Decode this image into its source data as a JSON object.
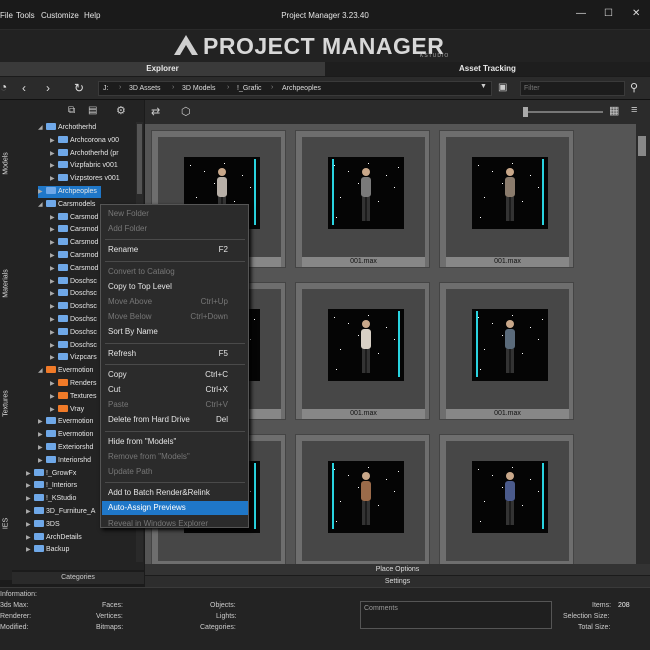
{
  "menu": {
    "file": "File",
    "tools": "Tools",
    "customize": "Customize",
    "help": "Help"
  },
  "window": {
    "title": "Project Manager 3.23.40",
    "minimize": "—",
    "maximize": "☐",
    "close": "✕"
  },
  "banner": {
    "logo": "PROJECT MANAGER",
    "logo_sub": "KSTUDIO"
  },
  "tabs": {
    "explorer": "Explorer",
    "asset_tracking": "Asset Tracking"
  },
  "breadcrumb": [
    "J:",
    "3D Assets",
    "3D Models",
    "!_Grafic",
    "Archpeoples"
  ],
  "filter_placeholder": "Filter",
  "side_tabs": [
    "Models",
    "Materials",
    "Textures",
    "IES"
  ],
  "tree": [
    {
      "label": "Archotherhd",
      "icon": "folder-blue",
      "depth": 1,
      "expanded": true
    },
    {
      "label": "Archcorona v00",
      "icon": "folder-blue",
      "depth": 2
    },
    {
      "label": "Archotherhd (pr",
      "icon": "folder-blue",
      "depth": 2
    },
    {
      "label": "Vizpfabric v001",
      "icon": "folder-blue",
      "depth": 2
    },
    {
      "label": "Vizpstores v001",
      "icon": "folder-blue",
      "depth": 2
    },
    {
      "label": "Archpeoples",
      "icon": "folder-blue",
      "depth": 1,
      "selected": true
    },
    {
      "label": "Carsmodels",
      "icon": "folder-blue",
      "depth": 1,
      "expanded": true
    },
    {
      "label": "Carsmod",
      "icon": "folder-blue",
      "depth": 2
    },
    {
      "label": "Carsmod",
      "icon": "folder-blue",
      "depth": 2
    },
    {
      "label": "Carsmod",
      "icon": "folder-blue",
      "depth": 2
    },
    {
      "label": "Carsmod",
      "icon": "folder-blue",
      "depth": 2
    },
    {
      "label": "Carsmod",
      "icon": "folder-blue",
      "depth": 2
    },
    {
      "label": "Doschsc",
      "icon": "folder-blue",
      "depth": 2
    },
    {
      "label": "Doschsc",
      "icon": "folder-blue",
      "depth": 2
    },
    {
      "label": "Doschsc",
      "icon": "folder-blue",
      "depth": 2
    },
    {
      "label": "Doschsc",
      "icon": "folder-blue",
      "depth": 2
    },
    {
      "label": "Doschsc",
      "icon": "folder-blue",
      "depth": 2
    },
    {
      "label": "Doschsc",
      "icon": "folder-blue",
      "depth": 2
    },
    {
      "label": "Vizpcars",
      "icon": "folder-blue",
      "depth": 2
    },
    {
      "label": "Evermotion",
      "icon": "folder-orange",
      "depth": 1,
      "expanded": true
    },
    {
      "label": "Renders",
      "icon": "folder-orange",
      "depth": 2
    },
    {
      "label": "Textures",
      "icon": "folder-orange",
      "depth": 2
    },
    {
      "label": "Vray",
      "icon": "folder-orange",
      "depth": 2
    },
    {
      "label": "Evermotion",
      "icon": "folder-blue",
      "depth": 1
    },
    {
      "label": "Evermotion",
      "icon": "folder-blue",
      "depth": 1
    },
    {
      "label": "Exteriorshd",
      "icon": "folder-blue",
      "depth": 1
    },
    {
      "label": "Interiorshd",
      "icon": "folder-blue",
      "depth": 1
    },
    {
      "label": "!_GrowFx",
      "icon": "folder-blue",
      "depth": 0
    },
    {
      "label": "!_Interiors",
      "icon": "folder-blue",
      "depth": 0
    },
    {
      "label": "!_KStudio",
      "icon": "folder-blue",
      "depth": 0
    },
    {
      "label": "3D_Furniture_A",
      "icon": "folder-blue",
      "depth": 0
    },
    {
      "label": "3DS",
      "icon": "folder-blue",
      "depth": 0
    },
    {
      "label": "ArchDetails",
      "icon": "folder-blue",
      "depth": 0
    },
    {
      "label": "Backup",
      "icon": "folder-blue",
      "depth": 0
    }
  ],
  "categories_label": "Categories",
  "thumbnails": [
    {
      "label": "001.max",
      "figure_color": "#b8b0a8"
    },
    {
      "label": "001.max",
      "figure_color": "#7a7a7a"
    },
    {
      "label": "001.max",
      "figure_color": "#8a7b6c"
    },
    {
      "label": "001.max",
      "figure_color": "#c8c0b5"
    },
    {
      "label": "001.max",
      "figure_color": "#d8d0c5"
    },
    {
      "label": "001.max",
      "figure_color": "#5a6a7a"
    },
    {
      "label": "",
      "figure_color": "#8b9b7a"
    },
    {
      "label": "",
      "figure_color": "#9b6b4a"
    },
    {
      "label": "",
      "figure_color": "#4a5a8b"
    }
  ],
  "context_menu": [
    {
      "label": "New Folder",
      "shortcut": "",
      "enabled": false
    },
    {
      "label": "Add Folder",
      "shortcut": "",
      "enabled": false
    },
    {
      "sep": true
    },
    {
      "label": "Rename",
      "shortcut": "F2",
      "enabled": true
    },
    {
      "sep": true
    },
    {
      "label": "Convert to Catalog",
      "shortcut": "",
      "enabled": false
    },
    {
      "label": "Copy to Top Level",
      "shortcut": "",
      "enabled": true
    },
    {
      "label": "Move Above",
      "shortcut": "Ctrl+Up",
      "enabled": false
    },
    {
      "label": "Move Below",
      "shortcut": "Ctrl+Down",
      "enabled": false
    },
    {
      "label": "Sort By Name",
      "shortcut": "",
      "enabled": true
    },
    {
      "sep": true
    },
    {
      "label": "Refresh",
      "shortcut": "F5",
      "enabled": true
    },
    {
      "sep": true
    },
    {
      "label": "Copy",
      "shortcut": "Ctrl+C",
      "enabled": true
    },
    {
      "label": "Cut",
      "shortcut": "Ctrl+X",
      "enabled": true
    },
    {
      "label": "Paste",
      "shortcut": "Ctrl+V",
      "enabled": false
    },
    {
      "label": "Delete from Hard Drive",
      "shortcut": "Del",
      "enabled": true
    },
    {
      "sep": true
    },
    {
      "label": "Hide from \"Models\"",
      "shortcut": "",
      "enabled": true
    },
    {
      "label": "Remove from \"Models\"",
      "shortcut": "",
      "enabled": false
    },
    {
      "label": "Update Path",
      "shortcut": "",
      "enabled": false
    },
    {
      "sep": true
    },
    {
      "label": "Add to Batch Render&Relink",
      "shortcut": "",
      "enabled": true
    },
    {
      "label": "Auto-Assign Previews",
      "shortcut": "",
      "enabled": true,
      "highlighted": true
    },
    {
      "label": "Reveal in Windows Explorer",
      "shortcut": "",
      "enabled": false
    }
  ],
  "place_options": "Place Options",
  "settings": "Settings",
  "info": {
    "header": "Information:",
    "max_label": "3ds Max:",
    "renderer_label": "Renderer:",
    "modified_label": "Modified:",
    "faces_label": "Faces:",
    "vertices_label": "Vertices:",
    "bitmaps_label": "Bitmaps:",
    "objects_label": "Objects:",
    "lights_label": "Lights:",
    "categories_label": "Categories:",
    "comments_label": "Comments",
    "items_label": "Items:",
    "items_value": "208",
    "selection_label": "Selection Size:",
    "total_label": "Total Size:"
  },
  "colors": {
    "accent": "#1f77c8",
    "folder_blue": "#6fa8e8",
    "folder_orange": "#f07a28",
    "stage_light": "#29d3e0"
  }
}
